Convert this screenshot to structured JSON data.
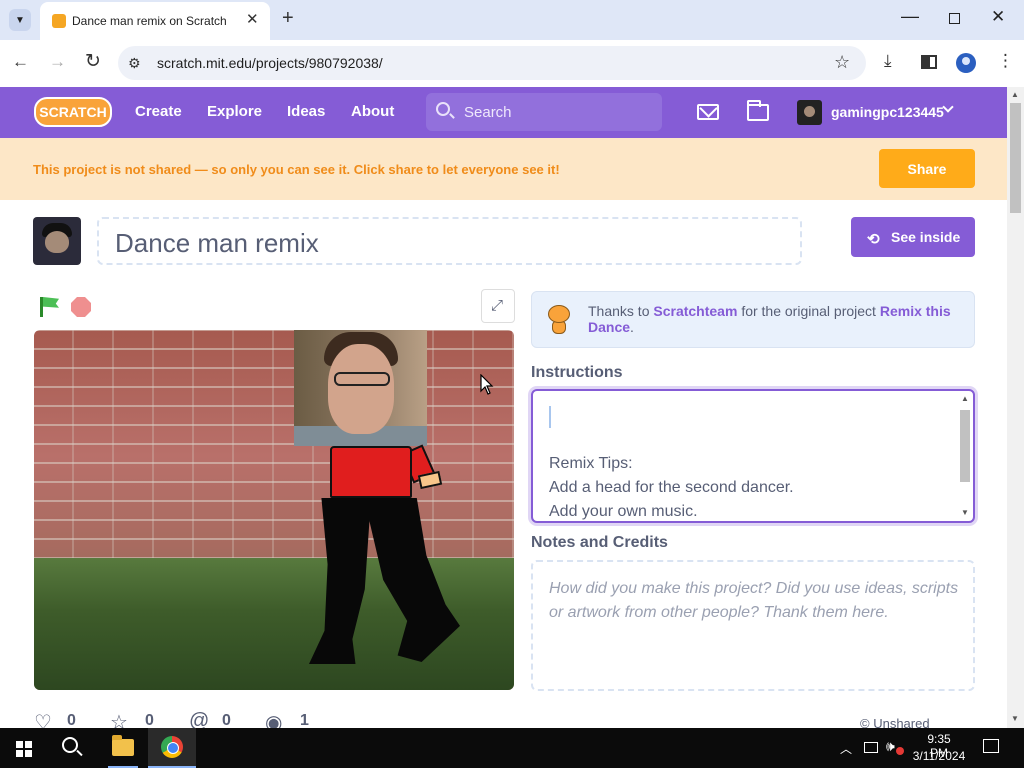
{
  "browser": {
    "tab_title": "Dance man remix on Scratch",
    "url": "scratch.mit.edu/projects/980792038/"
  },
  "nav": {
    "logo": "SCRATCH",
    "links": [
      "Create",
      "Explore",
      "Ideas",
      "About"
    ],
    "search_placeholder": "Search",
    "username": "gamingpc123445"
  },
  "banner": {
    "text": "This project is not shared — so only you can see it. Click share to let everyone see it!",
    "share_label": "Share"
  },
  "project": {
    "title": "Dance man remix",
    "see_inside_label": "See inside"
  },
  "remix": {
    "prefix": "Thanks to",
    "author": "Scratchteam",
    "middle": "for the original project",
    "original": "Remix this Dance",
    "suffix": "."
  },
  "instructions": {
    "heading": "Instructions",
    "lines": [
      "Remix Tips:",
      "Add a head for the second dancer.",
      "Add your own music."
    ]
  },
  "notes": {
    "heading": "Notes and Credits",
    "placeholder": "How did you make this project? Did you use ideas, scripts or artwork from other people? Thank them here."
  },
  "stats": {
    "loves": "0",
    "favorites": "0",
    "remixes": "0",
    "views": "1",
    "status": "Unshared"
  },
  "taskbar": {
    "time": "9:35 PM",
    "date": "3/11/2024"
  },
  "colors": {
    "scratch_purple": "#855cd6",
    "share_orange": "#ffab19",
    "banner_bg": "#fde7c7",
    "banner_text": "#f08c1a"
  }
}
